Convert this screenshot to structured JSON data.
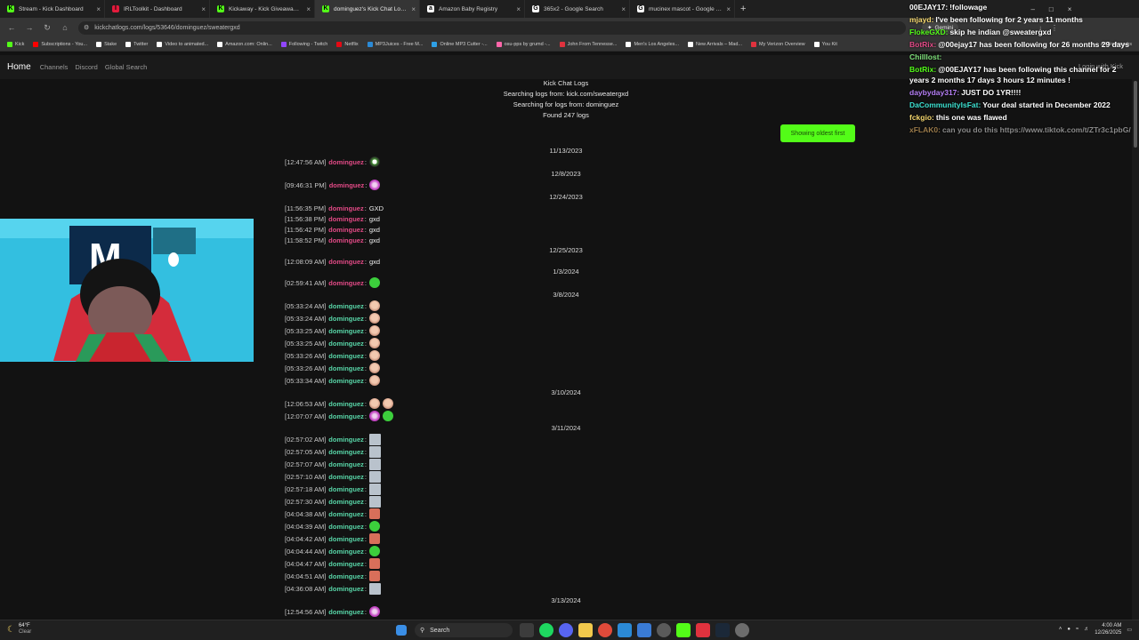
{
  "browser": {
    "tabs": [
      {
        "title": "Stream - Kick Dashboard",
        "favicon": "K",
        "color": "#53fc18"
      },
      {
        "title": "IRLToolkit - Dashboard",
        "favicon": "I",
        "color": "#e21b3c"
      },
      {
        "title": "Kickaway - Kick Giveaway Tool",
        "favicon": "K",
        "color": "#53fc18"
      },
      {
        "title": "dominguez's Kick Chat Logs in",
        "favicon": "K",
        "color": "#53fc18",
        "active": true
      },
      {
        "title": "Amazon Baby Registry",
        "favicon": "a",
        "color": "#ffffff"
      },
      {
        "title": "365x2 - Google Search",
        "favicon": "G",
        "color": "#ffffff"
      },
      {
        "title": "mucinex mascot - Google Sear",
        "favicon": "G",
        "color": "#ffffff"
      }
    ],
    "new_tab": "+",
    "url": "kickchatlogs.com/logs/53646/dominguez/sweatergxd",
    "bookmarks": [
      "Kick",
      "Subscriptions - You...",
      "Stake",
      "Twitter",
      "Video to animated...",
      "Amazon.com: Onlin...",
      "Following - Twitch",
      "Netflix",
      "MP3Juices - Free M...",
      "Online MP3 Cutter -...",
      "osu-pps by grumd -...",
      "John From Tennesse...",
      "Men's Los Angeles...",
      "New Arrivals – Mad...",
      "My Verizon Overview",
      "You Kit"
    ],
    "all_bookmarks": "All Bookmarks",
    "gemini": "Gemini"
  },
  "site": {
    "brand": "Home",
    "links": [
      "Channels",
      "Discord",
      "Global Search"
    ],
    "login": "Login with Kick"
  },
  "header": {
    "title": "Kick Chat Logs",
    "channel_line": "Searching logs from: kick.com/sweatergxd",
    "user_line": "Searching for logs from: dominguez",
    "found_line": "Found 247 logs",
    "oldest_button": "Showing oldest first"
  },
  "username": "dominguez",
  "dates": [
    {
      "label": "11/13/2023"
    },
    {
      "label": "12/8/2023"
    },
    {
      "label": "12/24/2023"
    },
    {
      "label": "12/25/2023"
    },
    {
      "label": "1/3/2024"
    },
    {
      "label": "3/8/2024"
    },
    {
      "label": "3/10/2024"
    },
    {
      "label": "3/11/2024"
    },
    {
      "label": "3/13/2024"
    }
  ],
  "messages": [
    {
      "ts": "[12:47:56 AM]",
      "msg": "",
      "emote": "soccer-ball-emote",
      "user_color": "#e24a86"
    },
    {
      "ts": "[09:46:31 PM]",
      "msg": "",
      "emote": "purple-face-emote",
      "user_color": "#e24a86"
    },
    {
      "ts": "[11:56:35 PM]",
      "msg": "GXD",
      "emote": "",
      "user_color": "#e24a86"
    },
    {
      "ts": "[11:56:38 PM]",
      "msg": "gxd",
      "emote": "",
      "user_color": "#e24a86"
    },
    {
      "ts": "[11:56:42 PM]",
      "msg": "gxd",
      "emote": "",
      "user_color": "#e24a86"
    },
    {
      "ts": "[11:58:52 PM]",
      "msg": "gxd",
      "emote": "",
      "user_color": "#e24a86"
    },
    {
      "ts": "[12:08:09 AM]",
      "msg": "gxd",
      "emote": "",
      "user_color": "#e24a86"
    },
    {
      "ts": "[02:59:41 AM]",
      "msg": "",
      "emote": "green-blob-emote",
      "user_color": "#e24a86"
    },
    {
      "ts": "[05:33:24 AM]",
      "msg": "",
      "emote": "face-emote",
      "user_color": "#58d6a8"
    },
    {
      "ts": "[05:33:24 AM]",
      "msg": "",
      "emote": "face-emote",
      "user_color": "#58d6a8"
    },
    {
      "ts": "[05:33:25 AM]",
      "msg": "",
      "emote": "face-emote",
      "user_color": "#58d6a8"
    },
    {
      "ts": "[05:33:25 AM]",
      "msg": "",
      "emote": "face-emote",
      "user_color": "#58d6a8"
    },
    {
      "ts": "[05:33:26 AM]",
      "msg": "",
      "emote": "face-emote",
      "user_color": "#58d6a8"
    },
    {
      "ts": "[05:33:26 AM]",
      "msg": "",
      "emote": "face-emote",
      "user_color": "#58d6a8"
    },
    {
      "ts": "[05:33:34 AM]",
      "msg": "",
      "emote": "face-emote",
      "user_color": "#58d6a8"
    },
    {
      "ts": "[12:06:53 AM]",
      "msg": "",
      "emote": "face-emote",
      "emote2": "face-emote",
      "user_color": "#58d6a8"
    },
    {
      "ts": "[12:07:07 AM]",
      "msg": "",
      "emote": "purple-face-emote",
      "emote2": "green-blob-emote",
      "user_color": "#58d6a8"
    },
    {
      "ts": "[02:57:02 AM]",
      "msg": "",
      "emote": "tall-figure-emote",
      "user_color": "#58d6a8"
    },
    {
      "ts": "[02:57:05 AM]",
      "msg": "",
      "emote": "tall-figure-emote",
      "user_color": "#58d6a8"
    },
    {
      "ts": "[02:57:07 AM]",
      "msg": "",
      "emote": "tall-figure-emote",
      "user_color": "#58d6a8"
    },
    {
      "ts": "[02:57:10 AM]",
      "msg": "",
      "emote": "tall-figure-emote",
      "user_color": "#58d6a8"
    },
    {
      "ts": "[02:57:18 AM]",
      "msg": "",
      "emote": "tall-figure-emote",
      "user_color": "#58d6a8"
    },
    {
      "ts": "[02:57:30 AM]",
      "msg": "",
      "emote": "tall-figure-emote",
      "user_color": "#58d6a8"
    },
    {
      "ts": "[04:04:38 AM]",
      "msg": "",
      "emote": "thumbs-emote",
      "user_color": "#58d6a8"
    },
    {
      "ts": "[04:04:39 AM]",
      "msg": "",
      "emote": "green-blob-emote",
      "user_color": "#58d6a8"
    },
    {
      "ts": "[04:04:42 AM]",
      "msg": "",
      "emote": "thumbs-emote",
      "user_color": "#58d6a8"
    },
    {
      "ts": "[04:04:44 AM]",
      "msg": "",
      "emote": "green-blob-emote",
      "user_color": "#58d6a8"
    },
    {
      "ts": "[04:04:47 AM]",
      "msg": "",
      "emote": "thumbs-emote",
      "user_color": "#58d6a8"
    },
    {
      "ts": "[04:04:51 AM]",
      "msg": "",
      "emote": "thumbs-emote",
      "user_color": "#58d6a8"
    },
    {
      "ts": "[04:36:08 AM]",
      "msg": "",
      "emote": "tall-figure-emote",
      "user_color": "#58d6a8"
    },
    {
      "ts": "[12:54:56 AM]",
      "msg": "",
      "emote": "purple-face-emote",
      "user_color": "#58d6a8"
    }
  ],
  "chat_overlay": [
    {
      "user": "00EJAY17:",
      "text": "!followage",
      "color": "#ffffff"
    },
    {
      "user": "mjayd:",
      "text": "I've been following for 2 years 11 months",
      "color": "#f5d76e"
    },
    {
      "user": "FlokeGXD:",
      "text": "skip he indian @sweatergxd",
      "color": "#53fc18"
    },
    {
      "user": "BotRix:",
      "text": "@00ejay17 has been following for 26 months 29 days",
      "color": "#e24a86"
    },
    {
      "user": "Chilllost:",
      "text": "",
      "color": "#7ee07a"
    },
    {
      "user": "BotRix:",
      "text": "@00EJAY17 has been following this channel for 2 years 2 months 17 days 3 hours 12 minutes !",
      "color": "#53fc18"
    },
    {
      "user": "daybyday317:",
      "text": "JUST DO 1YR!!!!",
      "color": "#b57ef5"
    },
    {
      "user": "DaCommunityIsFat:",
      "text": "Your deal started in December 2022",
      "color": "#3ce0d0"
    },
    {
      "user": "fckgio:",
      "text": "this one was flawed",
      "color": "#f5d76e"
    },
    {
      "user": "xFLAK0:",
      "text": "can you do this https://www.tiktok.com/t/ZTr3c1pbG/",
      "color": "#9a7a4a",
      "faded": true
    }
  ],
  "taskbar": {
    "weather_temp": "64°F",
    "weather_desc": "Clear",
    "search_label": "Search",
    "time": "4:00 AM",
    "date": "12/26/2025"
  }
}
